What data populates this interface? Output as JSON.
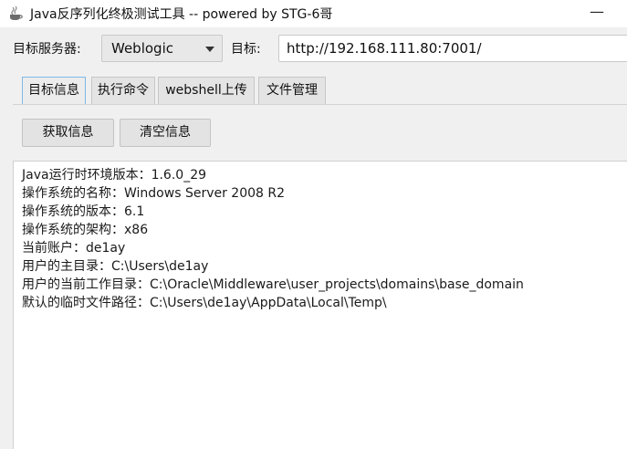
{
  "window": {
    "title": "Java反序列化终极测试工具  -- powered by STG-6哥",
    "icon": "java-coffee-icon",
    "minimize_glyph": "—"
  },
  "server_row": {
    "server_label": "目标服务器:",
    "server_value": "Weblogic",
    "target_label": "目标:",
    "target_value": "http://192.168.111.80:7001/"
  },
  "tabs": [
    {
      "label": "目标信息",
      "active": true
    },
    {
      "label": "执行命令",
      "active": false
    },
    {
      "label": "webshell上传",
      "active": false
    },
    {
      "label": "文件管理",
      "active": false
    }
  ],
  "buttons": {
    "get_info": "获取信息",
    "clear_info": "清空信息"
  },
  "output": {
    "lines": [
      "Java运行时环境版本：1.6.0_29",
      "操作系统的名称：Windows Server 2008 R2",
      "操作系统的版本：6.1",
      "操作系统的架构：x86",
      "当前账户：de1ay",
      "用户的主目录：C:\\Users\\de1ay",
      "用户的当前工作目录：C:\\Oracle\\Middleware\\user_projects\\domains\\base_domain",
      "默认的临时文件路径：C:\\Users\\de1ay\\AppData\\Local\\Temp\\"
    ]
  }
}
